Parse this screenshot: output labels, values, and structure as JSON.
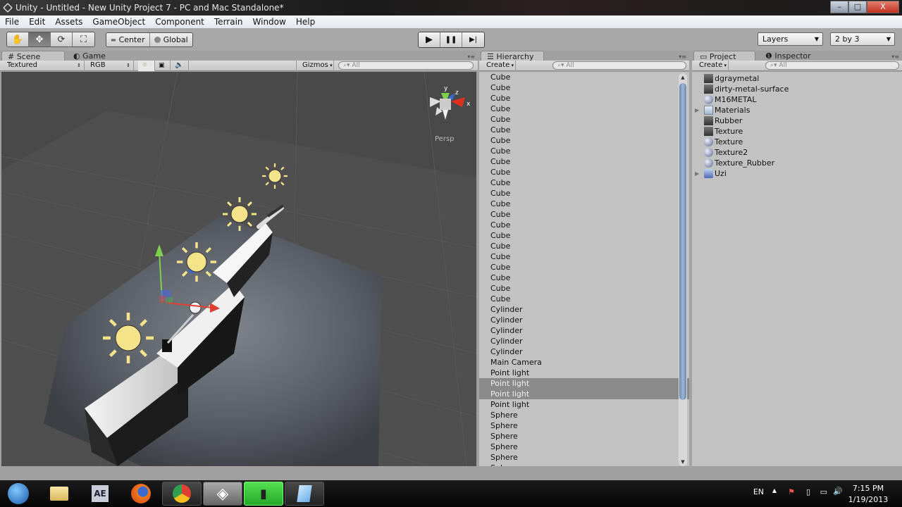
{
  "window": {
    "title": "Unity - Untitled - New Unity Project 7 - PC and Mac Standalone*",
    "controls": {
      "minimize": "–",
      "maximize": "□",
      "close": "X"
    }
  },
  "menu": [
    "File",
    "Edit",
    "Assets",
    "GameObject",
    "Component",
    "Terrain",
    "Window",
    "Help"
  ],
  "toolbar": {
    "transform_tools": [
      {
        "name": "hand-tool",
        "glyph": "✋",
        "active": false
      },
      {
        "name": "move-tool",
        "glyph": "✥",
        "active": true
      },
      {
        "name": "rotate-tool",
        "glyph": "⟳",
        "active": false
      },
      {
        "name": "scale-tool",
        "glyph": "⛶",
        "active": false
      }
    ],
    "pivot_label": "Center",
    "rotation_label": "Global",
    "play": {
      "play": "▶",
      "pause": "❚❚",
      "step": "▶|"
    },
    "layers_label": "Layers",
    "layout_label": "2 by 3"
  },
  "scene_panel": {
    "tabs": [
      {
        "label": "Scene",
        "icon": "#",
        "active": true
      },
      {
        "label": "Game",
        "icon": "◐",
        "active": false
      }
    ],
    "render_mode": "Textured",
    "color_mode": "RGB",
    "gizmos_label": "Gizmos",
    "search_placeholder": "All",
    "view_label": "Persp",
    "axis_labels": {
      "x": "x",
      "y": "y",
      "z": "z"
    }
  },
  "hierarchy": {
    "tab_label": "Hierarchy",
    "create_label": "Create",
    "search_placeholder": "All",
    "items": [
      {
        "label": "Cube",
        "selected": false
      },
      {
        "label": "Cube",
        "selected": false
      },
      {
        "label": "Cube",
        "selected": false
      },
      {
        "label": "Cube",
        "selected": false
      },
      {
        "label": "Cube",
        "selected": false
      },
      {
        "label": "Cube",
        "selected": false
      },
      {
        "label": "Cube",
        "selected": false
      },
      {
        "label": "Cube",
        "selected": false
      },
      {
        "label": "Cube",
        "selected": false
      },
      {
        "label": "Cube",
        "selected": false
      },
      {
        "label": "Cube",
        "selected": false
      },
      {
        "label": "Cube",
        "selected": false
      },
      {
        "label": "Cube",
        "selected": false
      },
      {
        "label": "Cube",
        "selected": false
      },
      {
        "label": "Cube",
        "selected": false
      },
      {
        "label": "Cube",
        "selected": false
      },
      {
        "label": "Cube",
        "selected": false
      },
      {
        "label": "Cube",
        "selected": false
      },
      {
        "label": "Cube",
        "selected": false
      },
      {
        "label": "Cube",
        "selected": false
      },
      {
        "label": "Cube",
        "selected": false
      },
      {
        "label": "Cube",
        "selected": false
      },
      {
        "label": "Cylinder",
        "selected": false
      },
      {
        "label": "Cylinder",
        "selected": false
      },
      {
        "label": "Cylinder",
        "selected": false
      },
      {
        "label": "Cylinder",
        "selected": false
      },
      {
        "label": "Cylinder",
        "selected": false
      },
      {
        "label": "Main Camera",
        "selected": false
      },
      {
        "label": "Point light",
        "selected": false
      },
      {
        "label": "Point light",
        "selected": true
      },
      {
        "label": "Point light",
        "selected": true
      },
      {
        "label": "Point light",
        "selected": false
      },
      {
        "label": "Sphere",
        "selected": false
      },
      {
        "label": "Sphere",
        "selected": false
      },
      {
        "label": "Sphere",
        "selected": false
      },
      {
        "label": "Sphere",
        "selected": false
      },
      {
        "label": "Sphere",
        "selected": false
      },
      {
        "label": "Sphere",
        "selected": false
      }
    ]
  },
  "project": {
    "tabs": [
      {
        "label": "Project",
        "active": true
      },
      {
        "label": "Inspector",
        "active": false
      }
    ],
    "create_label": "Create",
    "search_placeholder": "All",
    "items": [
      {
        "label": "dgraymetal",
        "icon": "texture-icon",
        "expandable": false
      },
      {
        "label": "dirty-metal-surface",
        "icon": "texture-icon",
        "expandable": false
      },
      {
        "label": "M16METAL",
        "icon": "material-icon",
        "expandable": false
      },
      {
        "label": "Materials",
        "icon": "folder-icon",
        "expandable": true
      },
      {
        "label": "Rubber",
        "icon": "texture-icon",
        "expandable": false
      },
      {
        "label": "Texture",
        "icon": "texture-icon",
        "expandable": false
      },
      {
        "label": "Texture",
        "icon": "material-icon",
        "expandable": false
      },
      {
        "label": "Texture2",
        "icon": "material-icon",
        "expandable": false
      },
      {
        "label": "Texture_Rubber",
        "icon": "material-icon",
        "expandable": false
      },
      {
        "label": "Uzi",
        "icon": "prefab-icon",
        "expandable": true
      }
    ]
  },
  "taskbar": {
    "apps": [
      "start",
      "explorer",
      "after-effects",
      "firefox",
      "chrome",
      "unity",
      "camtasia",
      "notepad"
    ],
    "ae_label": "AE",
    "language": "EN",
    "time": "7:15 PM",
    "date": "1/19/2013"
  },
  "colors": {
    "selection": "#8a8a8a",
    "scrollbar_thumb": "#7f97ba",
    "light_gizmo": "#f5e38a"
  }
}
